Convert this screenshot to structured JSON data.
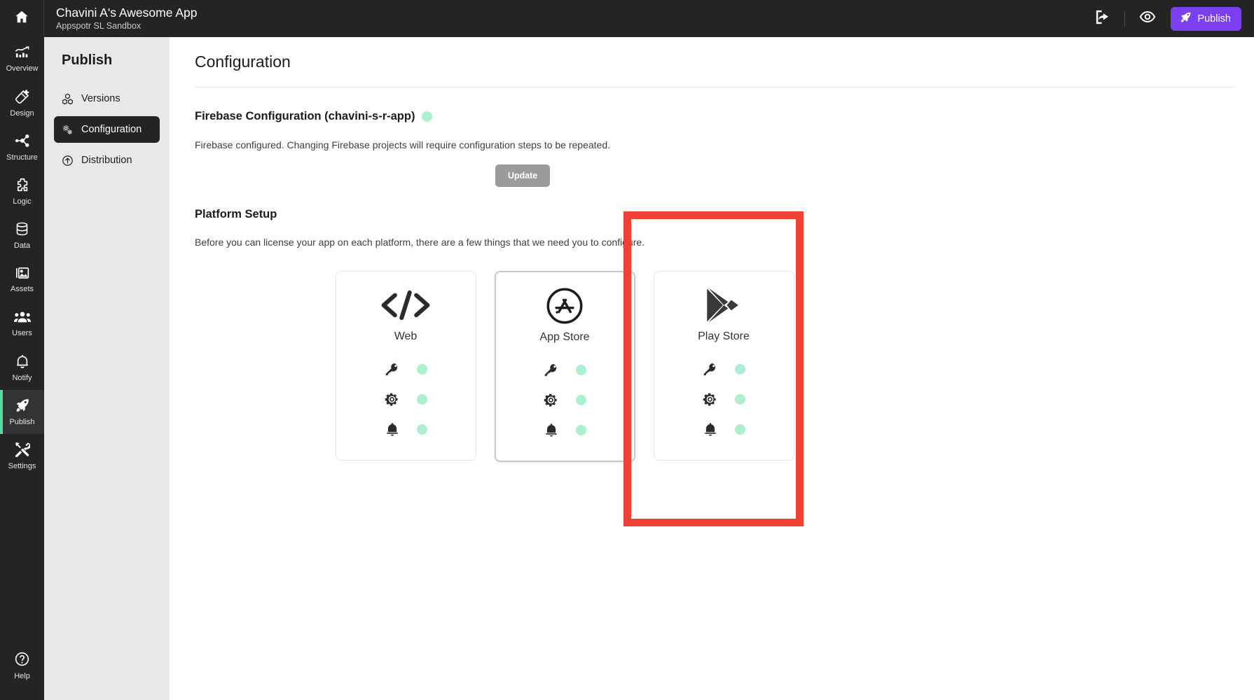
{
  "topbar": {
    "home_icon": "home-icon",
    "app_title": "Chavini A's Awesome App",
    "app_subtitle": "Appspotr SL Sandbox",
    "share_icon": "share-export-icon",
    "preview_icon": "eye-preview-icon",
    "publish_label": "Publish",
    "publish_icon": "rocket-icon",
    "publish_color": "#7B3FF2"
  },
  "rail": {
    "items": [
      {
        "label": "Overview",
        "icon": "chart-overview-icon",
        "active": false
      },
      {
        "label": "Design",
        "icon": "magic-wand-design-icon",
        "active": false
      },
      {
        "label": "Structure",
        "icon": "node-structure-icon",
        "active": false
      },
      {
        "label": "Logic",
        "icon": "puzzle-logic-icon",
        "active": false
      },
      {
        "label": "Data",
        "icon": "database-icon",
        "active": false
      },
      {
        "label": "Assets",
        "icon": "image-assets-icon",
        "active": false
      },
      {
        "label": "Users",
        "icon": "users-icon",
        "active": false
      },
      {
        "label": "Notify",
        "icon": "bell-notify-icon",
        "active": false
      },
      {
        "label": "Publish",
        "icon": "rocket-publish-icon",
        "active": true
      },
      {
        "label": "Settings",
        "icon": "tools-settings-icon",
        "active": false
      }
    ],
    "help": {
      "label": "Help",
      "icon": "question-help-icon"
    },
    "active_accent": "#5ED6A4"
  },
  "subnav": {
    "title": "Publish",
    "items": [
      {
        "label": "Versions",
        "icon": "cubes-versions-icon",
        "active": false
      },
      {
        "label": "Configuration",
        "icon": "gears-configuration-icon",
        "active": true
      },
      {
        "label": "Distribution",
        "icon": "arrow-up-circle-distribution-icon",
        "active": false
      }
    ]
  },
  "main": {
    "page_title": "Configuration",
    "firebase": {
      "heading": "Firebase Configuration (chavini-s-r-app)",
      "status_icon": "status-dot-green",
      "status_color": "#ADF0CE",
      "description": "Firebase configured. Changing Firebase projects will require configuration steps to be repeated.",
      "update_label": "Update"
    },
    "platform": {
      "heading": "Platform Setup",
      "description": "Before you can license your app on each platform, there are a few things that we need you to configure.",
      "cards": [
        {
          "name": "Web",
          "logo_icon": "code-brackets-icon",
          "highlighted": false,
          "features": [
            {
              "icon": "key-icon",
              "status_color": "#ADF0CE"
            },
            {
              "icon": "gear-icon",
              "status_color": "#ADF0CE"
            },
            {
              "icon": "bell-icon",
              "status_color": "#ADF0CE"
            }
          ]
        },
        {
          "name": "App Store",
          "logo_icon": "apple-app-store-icon",
          "highlighted": true,
          "features": [
            {
              "icon": "key-icon",
              "status_color": "#ADF0CE"
            },
            {
              "icon": "gear-icon",
              "status_color": "#ADF0CE"
            },
            {
              "icon": "bell-icon",
              "status_color": "#ADF0CE"
            }
          ]
        },
        {
          "name": "Play Store",
          "logo_icon": "google-play-store-icon",
          "highlighted": false,
          "features": [
            {
              "icon": "key-icon",
              "status_color": "#ADF0CE"
            },
            {
              "icon": "gear-icon",
              "status_color": "#ADF0CE"
            },
            {
              "icon": "bell-icon",
              "status_color": "#ADF0CE"
            }
          ]
        }
      ]
    }
  },
  "annotation": {
    "shape": "rectangle-highlight",
    "color": "#EF4136",
    "target": "App Store"
  }
}
